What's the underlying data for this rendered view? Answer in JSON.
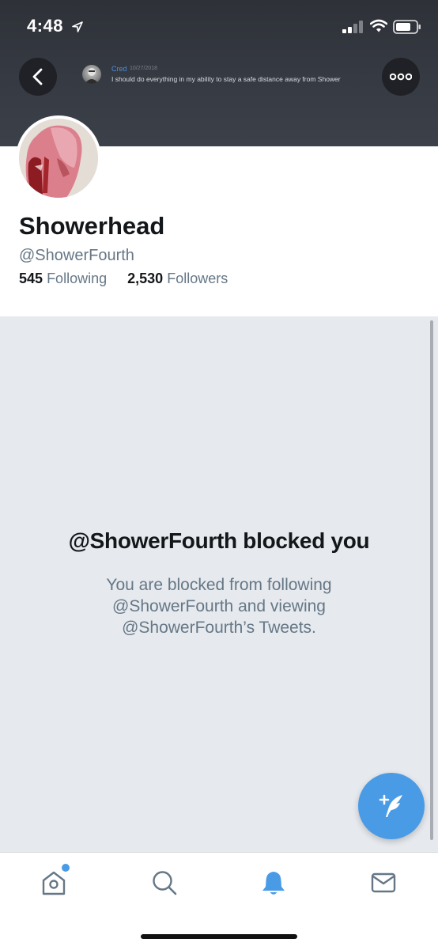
{
  "status_bar": {
    "time": "4:48"
  },
  "pinned_preview": {
    "name": "Cred",
    "date": "10/27/2018",
    "text": "I should do everything in my ability to stay a safe distance away from Shower"
  },
  "profile": {
    "display_name": "Showerhead",
    "handle": "@ShowerFourth",
    "following_count": "545",
    "following_label": "Following",
    "followers_count": "2,530",
    "followers_label": "Followers"
  },
  "blocked": {
    "title": "@ShowerFourth blocked you",
    "message": "You are blocked from following @ShowerFourth and viewing @ShowerFourth’s Tweets."
  },
  "icons": {
    "back": "chevron-left-icon",
    "more": "more-horizontal-icon",
    "compose": "compose-tweet-icon",
    "home": "home-icon",
    "search": "search-icon",
    "notifications": "bell-icon",
    "messages": "mail-icon"
  },
  "colors": {
    "accent": "#4a9be6",
    "header_bg": "#363a42",
    "blocked_bg": "#e6e9ed",
    "text_primary": "#14171a",
    "text_secondary": "#657786"
  },
  "tab_bar": {
    "active_tab": "notifications"
  }
}
